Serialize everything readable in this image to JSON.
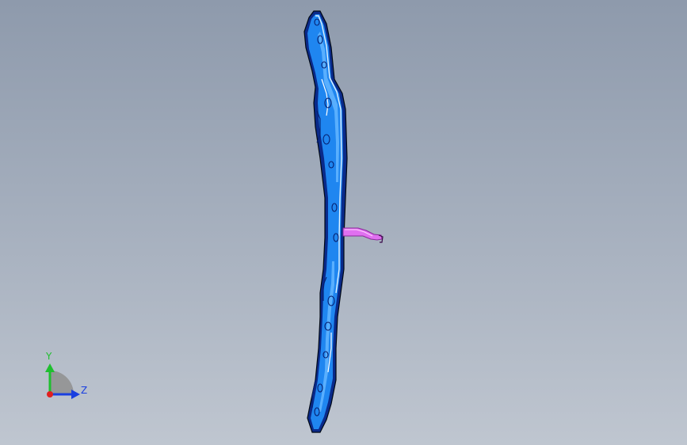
{
  "viewport": {
    "background_top": "#8e9aac",
    "background_bottom": "#bfc6d0"
  },
  "model": {
    "part_color": "#1f86f0",
    "part_shadow_color": "#0a2a8a",
    "part_highlight_color": "#dff1ff",
    "bracket_color": "#e070f0"
  },
  "triad": {
    "y_label": "Y",
    "z_label": "Z",
    "y_color": "#1fbf2f",
    "z_color": "#1a3fe0",
    "x_color": "#e02020"
  }
}
